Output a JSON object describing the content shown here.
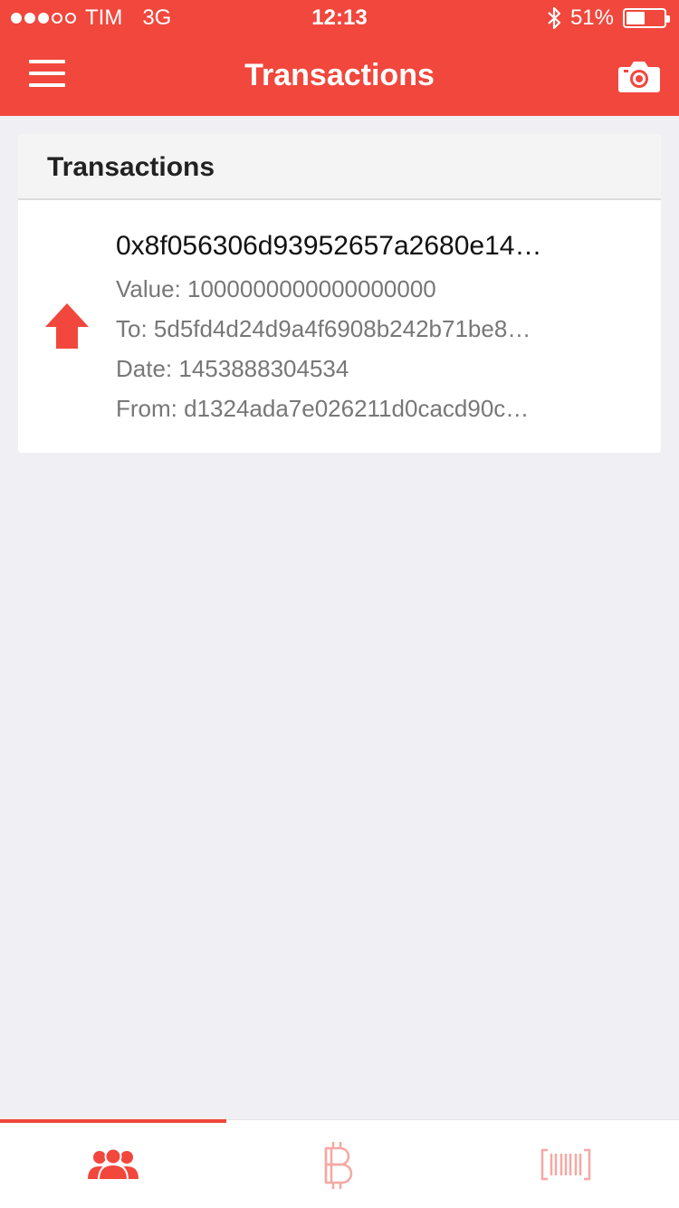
{
  "status_bar": {
    "carrier": "TIM",
    "network": "3G",
    "time": "12:13",
    "battery_percent": "51%",
    "signal_bars_filled": 3,
    "signal_bars_total": 5,
    "battery_level": 0.51,
    "icons": [
      "signal-dots-icon",
      "bluetooth-icon",
      "battery-icon"
    ]
  },
  "nav": {
    "title": "Transactions",
    "icons": {
      "left": "menu-icon",
      "right": "camera-icon"
    }
  },
  "card": {
    "header": "Transactions",
    "items": [
      {
        "direction_icon": "arrow-up-icon",
        "hash": "0x8f056306d93952657a2680e14…",
        "value": "Value: 1000000000000000000",
        "to": "To: 5d5fd4d24d9a4f6908b242b71be8…",
        "date": "Date: 1453888304534",
        "from": "From: d1324ada7e026211d0cacd90c…"
      }
    ]
  },
  "tabbar": {
    "tabs": [
      {
        "icon": "contacts-icon",
        "active": true
      },
      {
        "icon": "bitcoin-icon",
        "active": false
      },
      {
        "icon": "barcode-icon",
        "active": false
      }
    ]
  },
  "colors": {
    "accent": "#f1473c",
    "background": "#efeff4",
    "inactive_tab_icon": "#f5a8a2"
  }
}
